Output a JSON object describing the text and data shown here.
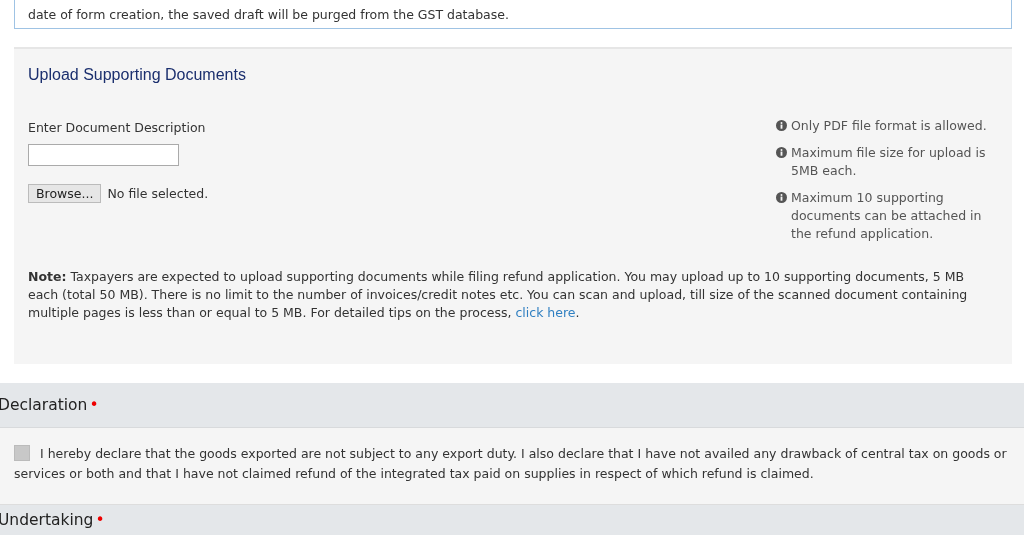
{
  "notice": {
    "text": "date of form creation, the saved draft will be purged from the GST database."
  },
  "upload": {
    "title": "Upload Supporting Documents",
    "description_label": "Enter Document Description",
    "browse_button": "Browse...",
    "file_status": "No file selected.",
    "info": [
      "Only PDF file format is allowed.",
      "Maximum file size for upload is 5MB each.",
      "Maximum 10 supporting documents can be attached in the refund application."
    ],
    "note": {
      "text": "**Note:** Taxpayers are expected to upload supporting documents while filing refund application. You may upload up to 10 supporting documents, 5 MB each (total 50 MB). There is no limit to the number of invoices/credit notes etc. You can scan and upload, till size of the scanned document containing multiple pages is less than or equal to 5 MB. For detailed tips on the process, ",
      "link": "click here",
      "after": "."
    }
  },
  "sections": [
    {
      "title": "Declaration",
      "required_mark": "•",
      "checkbox": {
        "checked": false,
        "text": "I hereby declare that the goods exported are not subject to any export duty. I also declare that I have not availed any drawback of central tax on goods or services or both and that I have not claimed refund of the integrated tax paid on supplies in respect of which refund is claimed."
      }
    },
    {
      "title": "Undertaking",
      "required_mark": "•"
    }
  ]
}
